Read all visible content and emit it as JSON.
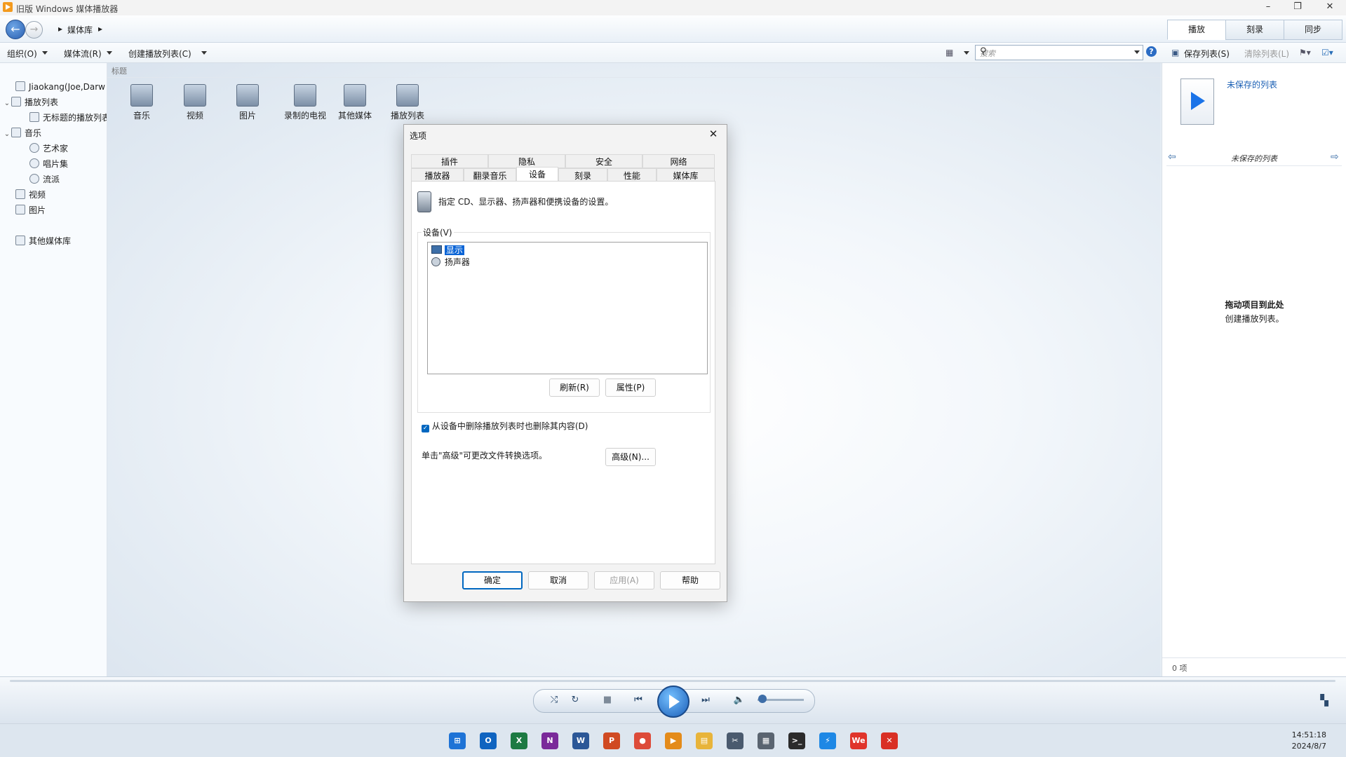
{
  "window": {
    "title": "旧版 Windows 媒体播放器",
    "minimize": "–",
    "restore": "❐",
    "close": "✕"
  },
  "nav": {
    "back": "←",
    "forward": "→",
    "breadcrumb": "媒体库",
    "crumb_arrow": "▸"
  },
  "play_tabs": [
    "播放",
    "刻录",
    "同步"
  ],
  "toolbar": {
    "organize": "组织(O)",
    "stream": "媒体流(R)",
    "create_playlist": "创建播放列表(C)",
    "search_placeholder": "搜索",
    "help": "?"
  },
  "right_toolbar": {
    "save_list": "保存列表(S)",
    "clear_list": "清除列表(L)"
  },
  "sidebar": {
    "items": [
      {
        "label": "Jiaokang(Joe,Darw",
        "chevron": ""
      },
      {
        "label": "播放列表",
        "chevron": "⌄"
      },
      {
        "label": "无标题的播放列表",
        "chevron": ""
      },
      {
        "label": "音乐",
        "chevron": "⌄"
      },
      {
        "label": "艺术家",
        "chevron": ""
      },
      {
        "label": "唱片集",
        "chevron": ""
      },
      {
        "label": "流派",
        "chevron": ""
      },
      {
        "label": "视频",
        "chevron": ""
      },
      {
        "label": "图片",
        "chevron": ""
      },
      {
        "label": "其他媒体库",
        "chevron": ""
      }
    ]
  },
  "content": {
    "column_header": "标题",
    "tiles": [
      {
        "label": "音乐",
        "icon": "music-icon"
      },
      {
        "label": "视频",
        "icon": "video-icon"
      },
      {
        "label": "图片",
        "icon": "picture-icon"
      },
      {
        "label": "录制的电视",
        "icon": "tv-icon"
      },
      {
        "label": "其他媒体",
        "icon": "other-media-icon"
      },
      {
        "label": "播放列表",
        "icon": "playlist-icon"
      }
    ]
  },
  "right_pane": {
    "unsaved_link": "未保存的列表",
    "list_title": "未保存的列表",
    "drag_title": "拖动项目到此处",
    "drag_sub": "创建播放列表。",
    "count": "0 项"
  },
  "dialog": {
    "title": "选项",
    "close": "✕",
    "tabs_row1": [
      "插件",
      "隐私",
      "安全",
      "网络"
    ],
    "tabs_row2": [
      "播放器",
      "翻录音乐",
      "设备",
      "刻录",
      "性能",
      "媒体库"
    ],
    "selected_tab": "设备",
    "description": "指定 CD、显示器、扬声器和便携设备的设置。",
    "devices_label": "设备(V)",
    "devices": [
      "显示",
      "扬声器"
    ],
    "refresh": "刷新(R)",
    "properties": "属性(P)",
    "delete_checkbox": "从设备中删除播放列表时也删除其内容(D)",
    "delete_checked": true,
    "advanced_hint": "单击\"高级\"可更改文件转换选项。",
    "advanced": "高级(N)...",
    "ok": "确定",
    "cancel": "取消",
    "apply": "应用(A)",
    "help": "帮助"
  },
  "player": {
    "shuffle": "⤭",
    "repeat": "↻",
    "stop": "■",
    "prev": "⏮",
    "next": "⏭",
    "mute": "🔈",
    "volume_fraction": 0.1
  },
  "taskbar": {
    "apps": [
      {
        "name": "start",
        "glyph": "⊞",
        "color": "#1e73d6"
      },
      {
        "name": "outlook",
        "glyph": "O",
        "color": "#0f64c0"
      },
      {
        "name": "excel",
        "glyph": "X",
        "color": "#1d7a43"
      },
      {
        "name": "onenote",
        "glyph": "N",
        "color": "#7a2a9a"
      },
      {
        "name": "word",
        "glyph": "W",
        "color": "#2b5797"
      },
      {
        "name": "powerpoint",
        "glyph": "P",
        "color": "#d04a22"
      },
      {
        "name": "chrome",
        "glyph": "●",
        "color": "#dd4b39"
      },
      {
        "name": "media-player",
        "glyph": "▶",
        "color": "#e48b1a"
      },
      {
        "name": "file-explorer",
        "glyph": "▤",
        "color": "#e8b43a"
      },
      {
        "name": "snipping",
        "glyph": "✂",
        "color": "#4a5a6e"
      },
      {
        "name": "calculator",
        "glyph": "▦",
        "color": "#5a6470"
      },
      {
        "name": "terminal",
        "glyph": ">_",
        "color": "#2b2b2b"
      },
      {
        "name": "thunder",
        "glyph": "⚡",
        "color": "#1e88e5"
      },
      {
        "name": "wps",
        "glyph": "We",
        "color": "#e0342b"
      },
      {
        "name": "xmind",
        "glyph": "✕",
        "color": "#d93025"
      }
    ],
    "time": "14:51:18",
    "date": "2024/8/7"
  }
}
